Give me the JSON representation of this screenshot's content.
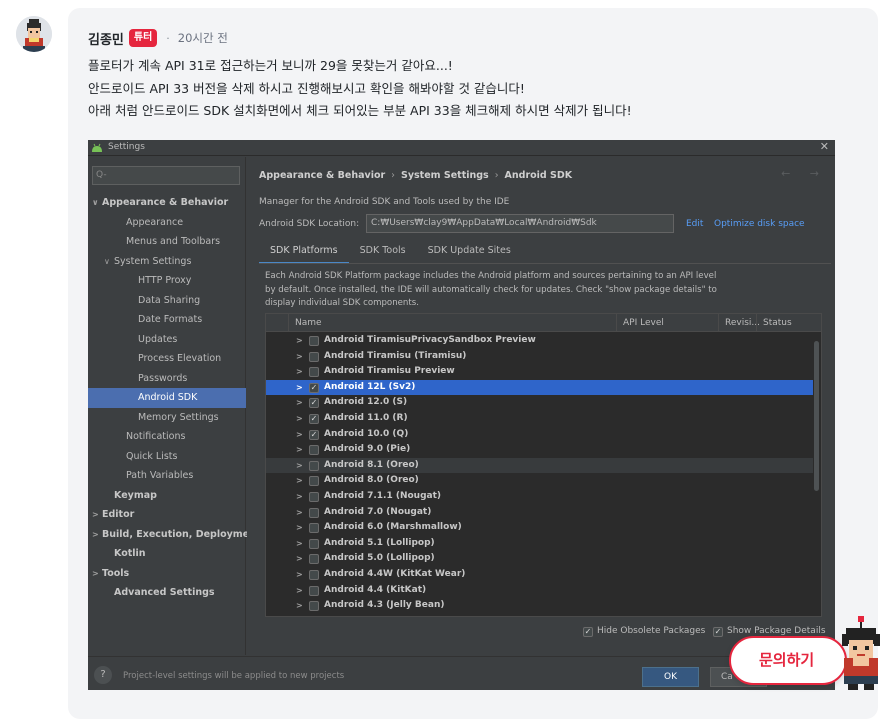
{
  "comment": {
    "author": "김종민",
    "badge": "튜터",
    "separator": "·",
    "time": "20시간 전",
    "lines": [
      "플로터가 계속 API 31로 접근하는거 보니까 29을 못찾는거 같아요...!",
      "안드로이드 API 33 버전을 삭제 하시고 진행해보시고 확인을 해봐야할 것 같습니다!",
      "아래 처럼 안드로이드 SDK 설치화면에서 체크 되어있는 부분 API 33을 체크해제 하시면 삭제가 됩니다!"
    ]
  },
  "ide": {
    "title": "Settings",
    "close": "✕",
    "search_placeholder": "Q-",
    "tree": [
      {
        "label": "Appearance & Behavior",
        "arrow": "∨",
        "bold": true
      },
      {
        "label": "Appearance",
        "arrow": ""
      },
      {
        "label": "Menus and Toolbars",
        "arrow": ""
      },
      {
        "label": "System Settings",
        "arrow": "∨"
      },
      {
        "label": "HTTP Proxy",
        "arrow": ""
      },
      {
        "label": "Data Sharing",
        "arrow": ""
      },
      {
        "label": "Date Formats",
        "arrow": ""
      },
      {
        "label": "Updates",
        "arrow": ""
      },
      {
        "label": "Process Elevation",
        "arrow": ""
      },
      {
        "label": "Passwords",
        "arrow": ""
      },
      {
        "label": "Android SDK",
        "arrow": "",
        "selected": true
      },
      {
        "label": "Memory Settings",
        "arrow": ""
      },
      {
        "label": "Notifications",
        "arrow": ""
      },
      {
        "label": "Quick Lists",
        "arrow": ""
      },
      {
        "label": "Path Variables",
        "arrow": ""
      },
      {
        "label": "Keymap",
        "arrow": "",
        "bold": true
      },
      {
        "label": "Editor",
        "arrow": ">",
        "bold": true
      },
      {
        "label": "Build, Execution, Deployment",
        "arrow": ">",
        "bold": true
      },
      {
        "label": "Kotlin",
        "arrow": "",
        "bold": true
      },
      {
        "label": "Tools",
        "arrow": ">",
        "bold": true
      },
      {
        "label": "Advanced Settings",
        "arrow": "",
        "bold": true
      }
    ],
    "breadcrumb": [
      "Appearance & Behavior",
      "System Settings",
      "Android SDK"
    ],
    "breadcrumb_sep": "›",
    "nav_arrows": "← →",
    "description": "Manager for the Android SDK and Tools used by the IDE",
    "location_label": "Android SDK Location:",
    "location_value": "C:₩Users₩clay9₩AppData₩Local₩Android₩Sdk",
    "edit_link": "Edit",
    "optimize_link": "Optimize disk space",
    "tabs": [
      "SDK Platforms",
      "SDK Tools",
      "SDK Update Sites"
    ],
    "panel_text": [
      "Each Android SDK Platform package includes the Android platform and sources pertaining to an API level",
      "by default. Once installed, the IDE will automatically check for updates. Check \"show package details\" to",
      "display individual SDK components."
    ],
    "columns": [
      "Name",
      "API Level",
      "Revisi...",
      "Status"
    ],
    "rows": [
      {
        "name": "Android TiramisuPrivacySandbox Preview",
        "checked": false
      },
      {
        "name": "Android Tiramisu (Tiramisu)",
        "checked": false
      },
      {
        "name": "Android Tiramisu Preview",
        "checked": false
      },
      {
        "name": "Android 12L (Sv2)",
        "checked": true,
        "selected": true
      },
      {
        "name": "Android 12.0 (S)",
        "checked": true
      },
      {
        "name": "Android 11.0 (R)",
        "checked": true
      },
      {
        "name": "Android 10.0 (Q)",
        "checked": true
      },
      {
        "name": "Android 9.0 (Pie)",
        "checked": false
      },
      {
        "name": "Android 8.1 (Oreo)",
        "checked": false,
        "hover": true
      },
      {
        "name": "Android 8.0 (Oreo)",
        "checked": false
      },
      {
        "name": "Android 7.1.1 (Nougat)",
        "checked": false
      },
      {
        "name": "Android 7.0 (Nougat)",
        "checked": false
      },
      {
        "name": "Android 6.0 (Marshmallow)",
        "checked": false
      },
      {
        "name": "Android 5.1 (Lollipop)",
        "checked": false
      },
      {
        "name": "Android 5.0 (Lollipop)",
        "checked": false
      },
      {
        "name": "Android 4.4W (KitKat Wear)",
        "checked": false
      },
      {
        "name": "Android 4.4 (KitKat)",
        "checked": false
      },
      {
        "name": "Android 4.3 (Jelly Bean)",
        "checked": false
      }
    ],
    "row_arrow": ">",
    "check_glyph": "✓",
    "hide_obsolete": "Hide Obsolete Packages",
    "show_details": "Show Package Details",
    "help": "?",
    "footer_note": "Project-level settings will be applied to new projects",
    "ok": "OK",
    "cancel": "Ca"
  },
  "floating": {
    "inquire_label": "문의하기"
  },
  "colors": {
    "brand_red": "#e5263e",
    "ide_bg": "#3c3f41",
    "selection_blue": "#2f65ca",
    "tree_selection": "#4b6eaf",
    "link_blue": "#589df6"
  }
}
